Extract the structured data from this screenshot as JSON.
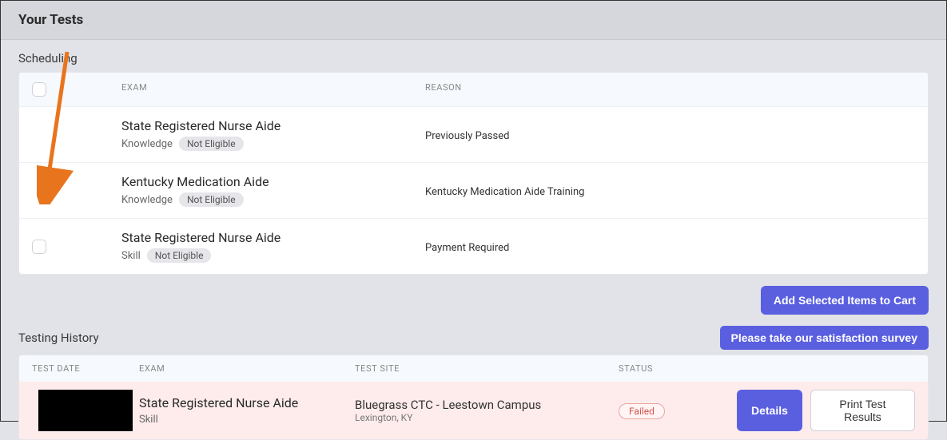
{
  "header": {
    "title": "Your Tests"
  },
  "scheduling": {
    "title": "Scheduling",
    "columns": {
      "exam": "EXAM",
      "reason": "REASON"
    },
    "rows": [
      {
        "exam": "State Registered Nurse Aide",
        "type": "Knowledge",
        "badge": "Not Eligible",
        "reason": "Previously Passed",
        "has_checkbox": false
      },
      {
        "exam": "Kentucky Medication Aide",
        "type": "Knowledge",
        "badge": "Not Eligible",
        "reason": "Kentucky Medication Aide Training",
        "has_checkbox": false
      },
      {
        "exam": "State Registered Nurse Aide",
        "type": "Skill",
        "badge": "Not Eligible",
        "reason": "Payment Required",
        "has_checkbox": true
      }
    ],
    "add_button": "Add Selected Items to Cart"
  },
  "history": {
    "title": "Testing History",
    "survey_button": "Please take our satisfaction survey",
    "columns": {
      "date": "TEST DATE",
      "exam": "EXAM",
      "site": "TEST SITE",
      "status": "STATUS"
    },
    "rows": [
      {
        "date": "",
        "exam": "State Registered Nurse Aide",
        "type": "Skill",
        "site": "Bluegrass CTC - Leestown Campus",
        "site_sub": "Lexington, KY",
        "status": "Failed",
        "details_btn": "Details",
        "print_btn": "Print Test Results"
      }
    ]
  }
}
